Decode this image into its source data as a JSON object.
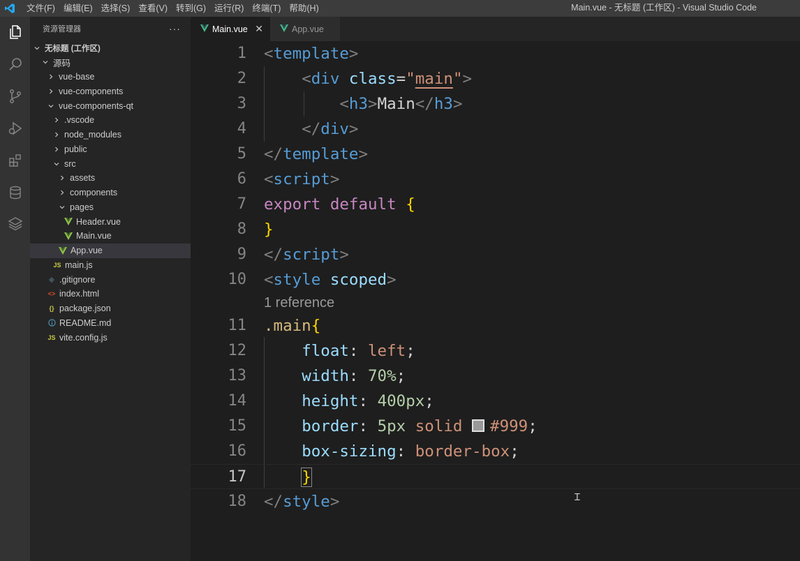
{
  "menu": [
    "文件(F)",
    "编辑(E)",
    "选择(S)",
    "查看(V)",
    "转到(G)",
    "运行(R)",
    "终端(T)",
    "帮助(H)"
  ],
  "window_title": "Main.vue - 无标题 (工作区) - Visual Studio Code",
  "activity_icons": [
    "explorer-icon",
    "search-icon",
    "source-control-icon",
    "run-debug-icon",
    "extensions-icon",
    "database-icon",
    "layers-icon"
  ],
  "sidebar": {
    "title": "资源管理器",
    "more": "···",
    "tree": [
      {
        "label": "无标题 (工作区)",
        "twisty": "open",
        "icon": "",
        "bold": true
      },
      {
        "label": "源码",
        "twisty": "open",
        "icon": ""
      },
      {
        "label": "vue-base",
        "twisty": "closed",
        "icon": ""
      },
      {
        "label": "vue-components",
        "twisty": "closed",
        "icon": ""
      },
      {
        "label": "vue-components-qt",
        "twisty": "open",
        "icon": ""
      },
      {
        "label": ".vscode",
        "twisty": "closed",
        "icon": ""
      },
      {
        "label": "node_modules",
        "twisty": "closed",
        "icon": ""
      },
      {
        "label": "public",
        "twisty": "closed",
        "icon": ""
      },
      {
        "label": "src",
        "twisty": "open",
        "icon": ""
      },
      {
        "label": "assets",
        "twisty": "closed",
        "icon": ""
      },
      {
        "label": "components",
        "twisty": "closed",
        "icon": ""
      },
      {
        "label": "pages",
        "twisty": "open",
        "icon": ""
      },
      {
        "label": "Header.vue",
        "twisty": "",
        "icon": "vue"
      },
      {
        "label": "Main.vue",
        "twisty": "",
        "icon": "vue"
      },
      {
        "label": "App.vue",
        "twisty": "",
        "icon": "vue",
        "selected": true
      },
      {
        "label": "main.js",
        "twisty": "",
        "icon": "js"
      },
      {
        "label": ".gitignore",
        "twisty": "",
        "icon": "git"
      },
      {
        "label": "index.html",
        "twisty": "",
        "icon": "html"
      },
      {
        "label": "package.json",
        "twisty": "",
        "icon": "json"
      },
      {
        "label": "README.md",
        "twisty": "",
        "icon": "info"
      },
      {
        "label": "vite.config.js",
        "twisty": "",
        "icon": "js"
      }
    ]
  },
  "tabs": [
    {
      "label": "Main.vue",
      "active": true,
      "close": "✕"
    },
    {
      "label": "App.vue",
      "active": false
    }
  ],
  "editor": {
    "codelens": "1 reference",
    "lines": [
      {
        "n": "1",
        "tokens": [
          [
            "t-punc",
            "<"
          ],
          [
            "t-tag",
            "template"
          ],
          [
            "t-punc",
            ">"
          ]
        ]
      },
      {
        "n": "2",
        "tokens": [
          [
            "t-text",
            "    "
          ],
          [
            "t-punc",
            "<"
          ],
          [
            "t-tag",
            "div"
          ],
          [
            "t-text",
            " "
          ],
          [
            "t-attr",
            "class"
          ],
          [
            "t-white",
            "="
          ],
          [
            "t-str",
            "\""
          ],
          [
            "t-str underline",
            "main"
          ],
          [
            "t-str",
            "\""
          ],
          [
            "t-punc",
            ">"
          ]
        ]
      },
      {
        "n": "3",
        "tokens": [
          [
            "t-text",
            "        "
          ],
          [
            "t-punc",
            "<"
          ],
          [
            "t-tag",
            "h3"
          ],
          [
            "t-punc",
            ">"
          ],
          [
            "t-text",
            "Main"
          ],
          [
            "t-punc",
            "</"
          ],
          [
            "t-tag",
            "h3"
          ],
          [
            "t-punc",
            ">"
          ]
        ]
      },
      {
        "n": "4",
        "tokens": [
          [
            "t-text",
            "    "
          ],
          [
            "t-punc",
            "</"
          ],
          [
            "t-tag",
            "div"
          ],
          [
            "t-punc",
            ">"
          ]
        ]
      },
      {
        "n": "5",
        "tokens": [
          [
            "t-punc",
            "</"
          ],
          [
            "t-tag",
            "template"
          ],
          [
            "t-punc",
            ">"
          ]
        ]
      },
      {
        "n": "6",
        "tokens": [
          [
            "t-punc",
            "<"
          ],
          [
            "t-tag",
            "script"
          ],
          [
            "t-punc",
            ">"
          ]
        ]
      },
      {
        "n": "7",
        "tokens": [
          [
            "t-kw",
            "export"
          ],
          [
            "t-text",
            " "
          ],
          [
            "t-kw",
            "default"
          ],
          [
            "t-text",
            " "
          ],
          [
            "t-brace",
            "{"
          ]
        ]
      },
      {
        "n": "8",
        "tokens": [
          [
            "t-brace",
            "}"
          ]
        ]
      },
      {
        "n": "9",
        "tokens": [
          [
            "t-punc",
            "</"
          ],
          [
            "t-tag",
            "script"
          ],
          [
            "t-punc",
            ">"
          ]
        ]
      },
      {
        "n": "10",
        "tokens": [
          [
            "t-punc",
            "<"
          ],
          [
            "t-tag",
            "style"
          ],
          [
            "t-text",
            " "
          ],
          [
            "t-attr",
            "scoped"
          ],
          [
            "t-punc",
            ">"
          ]
        ]
      },
      {
        "n": "11",
        "tokens": [
          [
            "t-sel",
            ".main"
          ],
          [
            "t-brace",
            "{"
          ]
        ]
      },
      {
        "n": "12",
        "tokens": [
          [
            "t-text",
            "    "
          ],
          [
            "t-prop",
            "float"
          ],
          [
            "t-white",
            ": "
          ],
          [
            "t-val",
            "left"
          ],
          [
            "t-white",
            ";"
          ]
        ]
      },
      {
        "n": "13",
        "tokens": [
          [
            "t-text",
            "    "
          ],
          [
            "t-prop",
            "width"
          ],
          [
            "t-white",
            ": "
          ],
          [
            "t-num",
            "70%"
          ],
          [
            "t-white",
            ";"
          ]
        ]
      },
      {
        "n": "14",
        "tokens": [
          [
            "t-text",
            "    "
          ],
          [
            "t-prop",
            "height"
          ],
          [
            "t-white",
            ": "
          ],
          [
            "t-num",
            "400px"
          ],
          [
            "t-white",
            ";"
          ]
        ]
      },
      {
        "n": "15",
        "tokens": [
          [
            "t-text",
            "    "
          ],
          [
            "t-prop",
            "border"
          ],
          [
            "t-white",
            ": "
          ],
          [
            "t-num",
            "5px"
          ],
          [
            "t-text",
            " "
          ],
          [
            "t-val",
            "solid"
          ],
          [
            "t-text",
            " "
          ],
          [
            "swatch",
            ""
          ],
          [
            "t-val",
            "#999"
          ],
          [
            "t-white",
            ";"
          ]
        ]
      },
      {
        "n": "16",
        "tokens": [
          [
            "t-text",
            "    "
          ],
          [
            "t-prop",
            "box-sizing"
          ],
          [
            "t-white",
            ": "
          ],
          [
            "t-val",
            "border-box"
          ],
          [
            "t-white",
            ";"
          ]
        ]
      },
      {
        "n": "17",
        "tokens": [
          [
            "t-text",
            "    "
          ],
          [
            "t-brace bracket-match",
            "}"
          ]
        ],
        "current": true
      },
      {
        "n": "18",
        "tokens": [
          [
            "t-punc",
            "</"
          ],
          [
            "t-tag",
            "style"
          ],
          [
            "t-punc",
            ">"
          ]
        ]
      }
    ]
  }
}
